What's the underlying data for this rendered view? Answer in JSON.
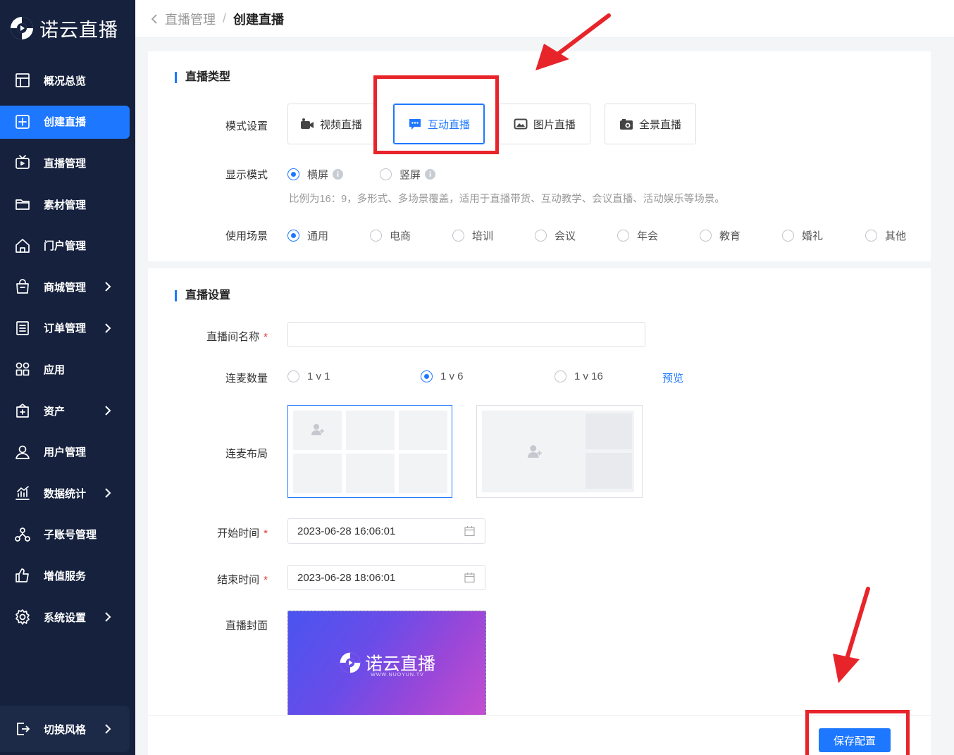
{
  "brand": {
    "name": "诺云直播"
  },
  "sidebar": {
    "items": [
      {
        "label": "概况总览",
        "icon": "dashboard-icon",
        "active": false,
        "has_children": false
      },
      {
        "label": "创建直播",
        "icon": "plus-square-icon",
        "active": true,
        "has_children": false
      },
      {
        "label": "直播管理",
        "icon": "tv-icon",
        "active": false,
        "has_children": false
      },
      {
        "label": "素材管理",
        "icon": "folder-icon",
        "active": false,
        "has_children": false
      },
      {
        "label": "门户管理",
        "icon": "home-icon",
        "active": false,
        "has_children": false
      },
      {
        "label": "商城管理",
        "icon": "shopping-bag-icon",
        "active": false,
        "has_children": true
      },
      {
        "label": "订单管理",
        "icon": "list-icon",
        "active": false,
        "has_children": true
      },
      {
        "label": "应用",
        "icon": "apps-grid-icon",
        "active": false,
        "has_children": false
      },
      {
        "label": "资产",
        "icon": "wallet-icon",
        "active": false,
        "has_children": true
      },
      {
        "label": "用户管理",
        "icon": "user-icon",
        "active": false,
        "has_children": false
      },
      {
        "label": "数据统计",
        "icon": "chart-icon",
        "active": false,
        "has_children": true
      },
      {
        "label": "子账号管理",
        "icon": "org-icon",
        "active": false,
        "has_children": false
      },
      {
        "label": "增值服务",
        "icon": "thumb-up-icon",
        "active": false,
        "has_children": false
      },
      {
        "label": "系统设置",
        "icon": "gear-icon",
        "active": false,
        "has_children": true
      }
    ],
    "switch_style": "切换风格"
  },
  "breadcrumb": {
    "parent": "直播管理",
    "separator": "/",
    "current": "创建直播"
  },
  "live_type": {
    "title": "直播类型",
    "mode_label": "模式设置",
    "modes": [
      {
        "label": "视频直播",
        "icon": "camera-icon",
        "selected": false
      },
      {
        "label": "互动直播",
        "icon": "chat-icon",
        "selected": true
      },
      {
        "label": "图片直播",
        "icon": "image-icon",
        "selected": false
      },
      {
        "label": "全景直播",
        "icon": "panorama-camera-icon",
        "selected": false
      }
    ],
    "display_label": "显示模式",
    "display_options": [
      {
        "label": "横屏",
        "selected": true
      },
      {
        "label": "竖屏",
        "selected": false
      }
    ],
    "display_hint": "比例为16：9，多形式、多场景覆盖，适用于直播带货、互动教学、会议直播、活动娱乐等场景。",
    "scene_label": "使用场景",
    "scenes": [
      {
        "label": "通用",
        "selected": true
      },
      {
        "label": "电商",
        "selected": false
      },
      {
        "label": "培训",
        "selected": false
      },
      {
        "label": "会议",
        "selected": false
      },
      {
        "label": "年会",
        "selected": false
      },
      {
        "label": "教育",
        "selected": false
      },
      {
        "label": "婚礼",
        "selected": false
      },
      {
        "label": "其他",
        "selected": false
      }
    ]
  },
  "live_settings": {
    "title": "直播设置",
    "name_label": "直播间名称",
    "name_value": "",
    "required_mark": "*",
    "mic_count_label": "连麦数量",
    "mic_options": [
      {
        "label": "1 v 1",
        "selected": false
      },
      {
        "label": "1 v 6",
        "selected": true
      },
      {
        "label": "1 v 16",
        "selected": false
      }
    ],
    "preview_link": "预览",
    "layout_label": "连麦布局",
    "start_label": "开始时间",
    "start_value": "2023-06-28 16:06:01",
    "end_label": "结束时间",
    "end_value": "2023-06-28 18:06:01",
    "cover_label": "直播封面",
    "cover_brand": "诺云直播",
    "cover_sub": "WWW.NUOYUN.TV"
  },
  "footer": {
    "save_label": "保存配置"
  },
  "colors": {
    "sidebar_bg": "#15213d",
    "accent": "#1e78ff",
    "annotation": "#e8242b"
  }
}
